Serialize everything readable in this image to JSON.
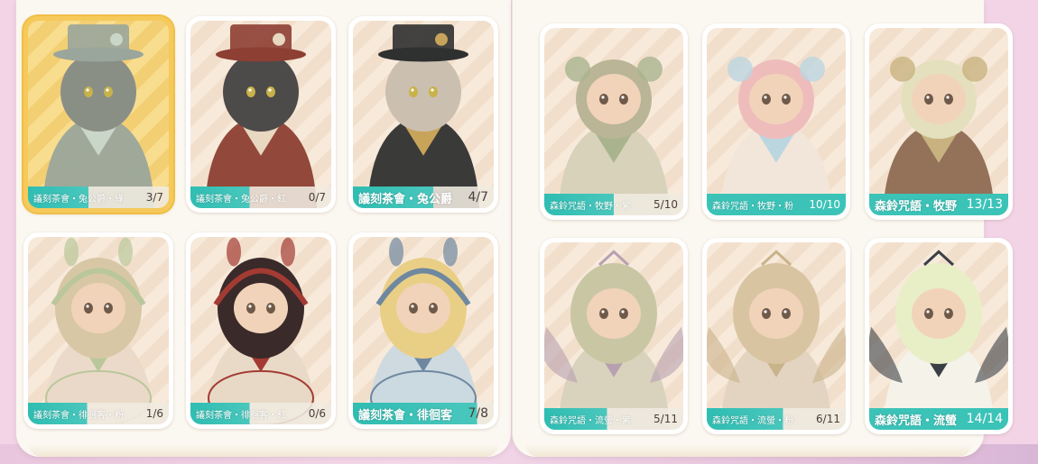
{
  "colors": {
    "teal": "#3cc3b8",
    "selected": "#f5c95a",
    "card_bg": "#f7eadb",
    "page_bg": "#f2d4e6"
  },
  "left_panel": {
    "cards": [
      {
        "name": "議刻茶會・兔公爵・綠",
        "count": "3/7",
        "selected": true,
        "big": false,
        "full": false,
        "outfit": "rabbit-duke-green",
        "hair": "#8a8f86",
        "cloth": "#9aa59b",
        "accent": "#c9d6c8"
      },
      {
        "name": "議刻茶會・兔公爵・紅",
        "count": "0/7",
        "selected": false,
        "big": false,
        "full": false,
        "outfit": "rabbit-duke-red",
        "hair": "#4d4a4a",
        "cloth": "#8c3f32",
        "accent": "#e8d7c1"
      },
      {
        "name": "議刻茶會・兔公爵",
        "count": "4/7",
        "selected": false,
        "big": true,
        "full": false,
        "outfit": "rabbit-duke",
        "hair": "#cbbfb0",
        "cloth": "#2f3030",
        "accent": "#c8a45a"
      },
      {
        "name": "議刻茶會・徘徊客・粉",
        "count": "1/6",
        "selected": false,
        "big": false,
        "full": false,
        "outfit": "wanderer-pink",
        "hair": "#d8c7a5",
        "cloth": "#ead9c8",
        "accent": "#b9c79a"
      },
      {
        "name": "議刻茶會・徘徊客・紅",
        "count": "0/6",
        "selected": false,
        "big": false,
        "full": false,
        "outfit": "wanderer-red",
        "hair": "#3a2a2a",
        "cloth": "#e8d9c6",
        "accent": "#a33b33"
      },
      {
        "name": "議刻茶會・徘徊客",
        "count": "7/8",
        "selected": false,
        "big": true,
        "full": false,
        "outfit": "wanderer",
        "hair": "#e9cf86",
        "cloth": "#cbd9e0",
        "accent": "#6f88a0"
      }
    ]
  },
  "right_panel": {
    "cards": [
      {
        "name": "森鈴咒語・牧野・紫",
        "count": "5/10",
        "selected": false,
        "big": false,
        "full": false,
        "outfit": "pasture-purple",
        "hair": "#b9b596",
        "cloth": "#d6d1b8",
        "accent": "#a9b48f"
      },
      {
        "name": "森鈴咒語・牧野・粉",
        "count": "10/10",
        "selected": false,
        "big": false,
        "full": true,
        "outfit": "pasture-pink",
        "hair": "#efbcbc",
        "cloth": "#f1e6da",
        "accent": "#bcd6e0"
      },
      {
        "name": "森鈴咒語・牧野",
        "count": "13/13",
        "selected": false,
        "big": true,
        "full": true,
        "outfit": "pasture",
        "hair": "#e4e0be",
        "cloth": "#8d6c52",
        "accent": "#c8b380"
      },
      {
        "name": "森鈴咒語・流螢・紫",
        "count": "5/11",
        "selected": false,
        "big": false,
        "full": false,
        "outfit": "firefly-purple",
        "hair": "#c9c6a4",
        "cloth": "#d7d2bd",
        "accent": "#b8a0b0"
      },
      {
        "name": "森鈴咒語・流螢・粉",
        "count": "6/11",
        "selected": false,
        "big": false,
        "full": false,
        "outfit": "firefly-pink",
        "hair": "#d9c4a2",
        "cloth": "#e0d3bf",
        "accent": "#c9b38a"
      },
      {
        "name": "森鈴咒語・流螢",
        "count": "14/14",
        "selected": false,
        "big": true,
        "full": true,
        "outfit": "firefly",
        "hair": "#e8efc6",
        "cloth": "#f3f2ea",
        "accent": "#3a3f46"
      }
    ]
  }
}
